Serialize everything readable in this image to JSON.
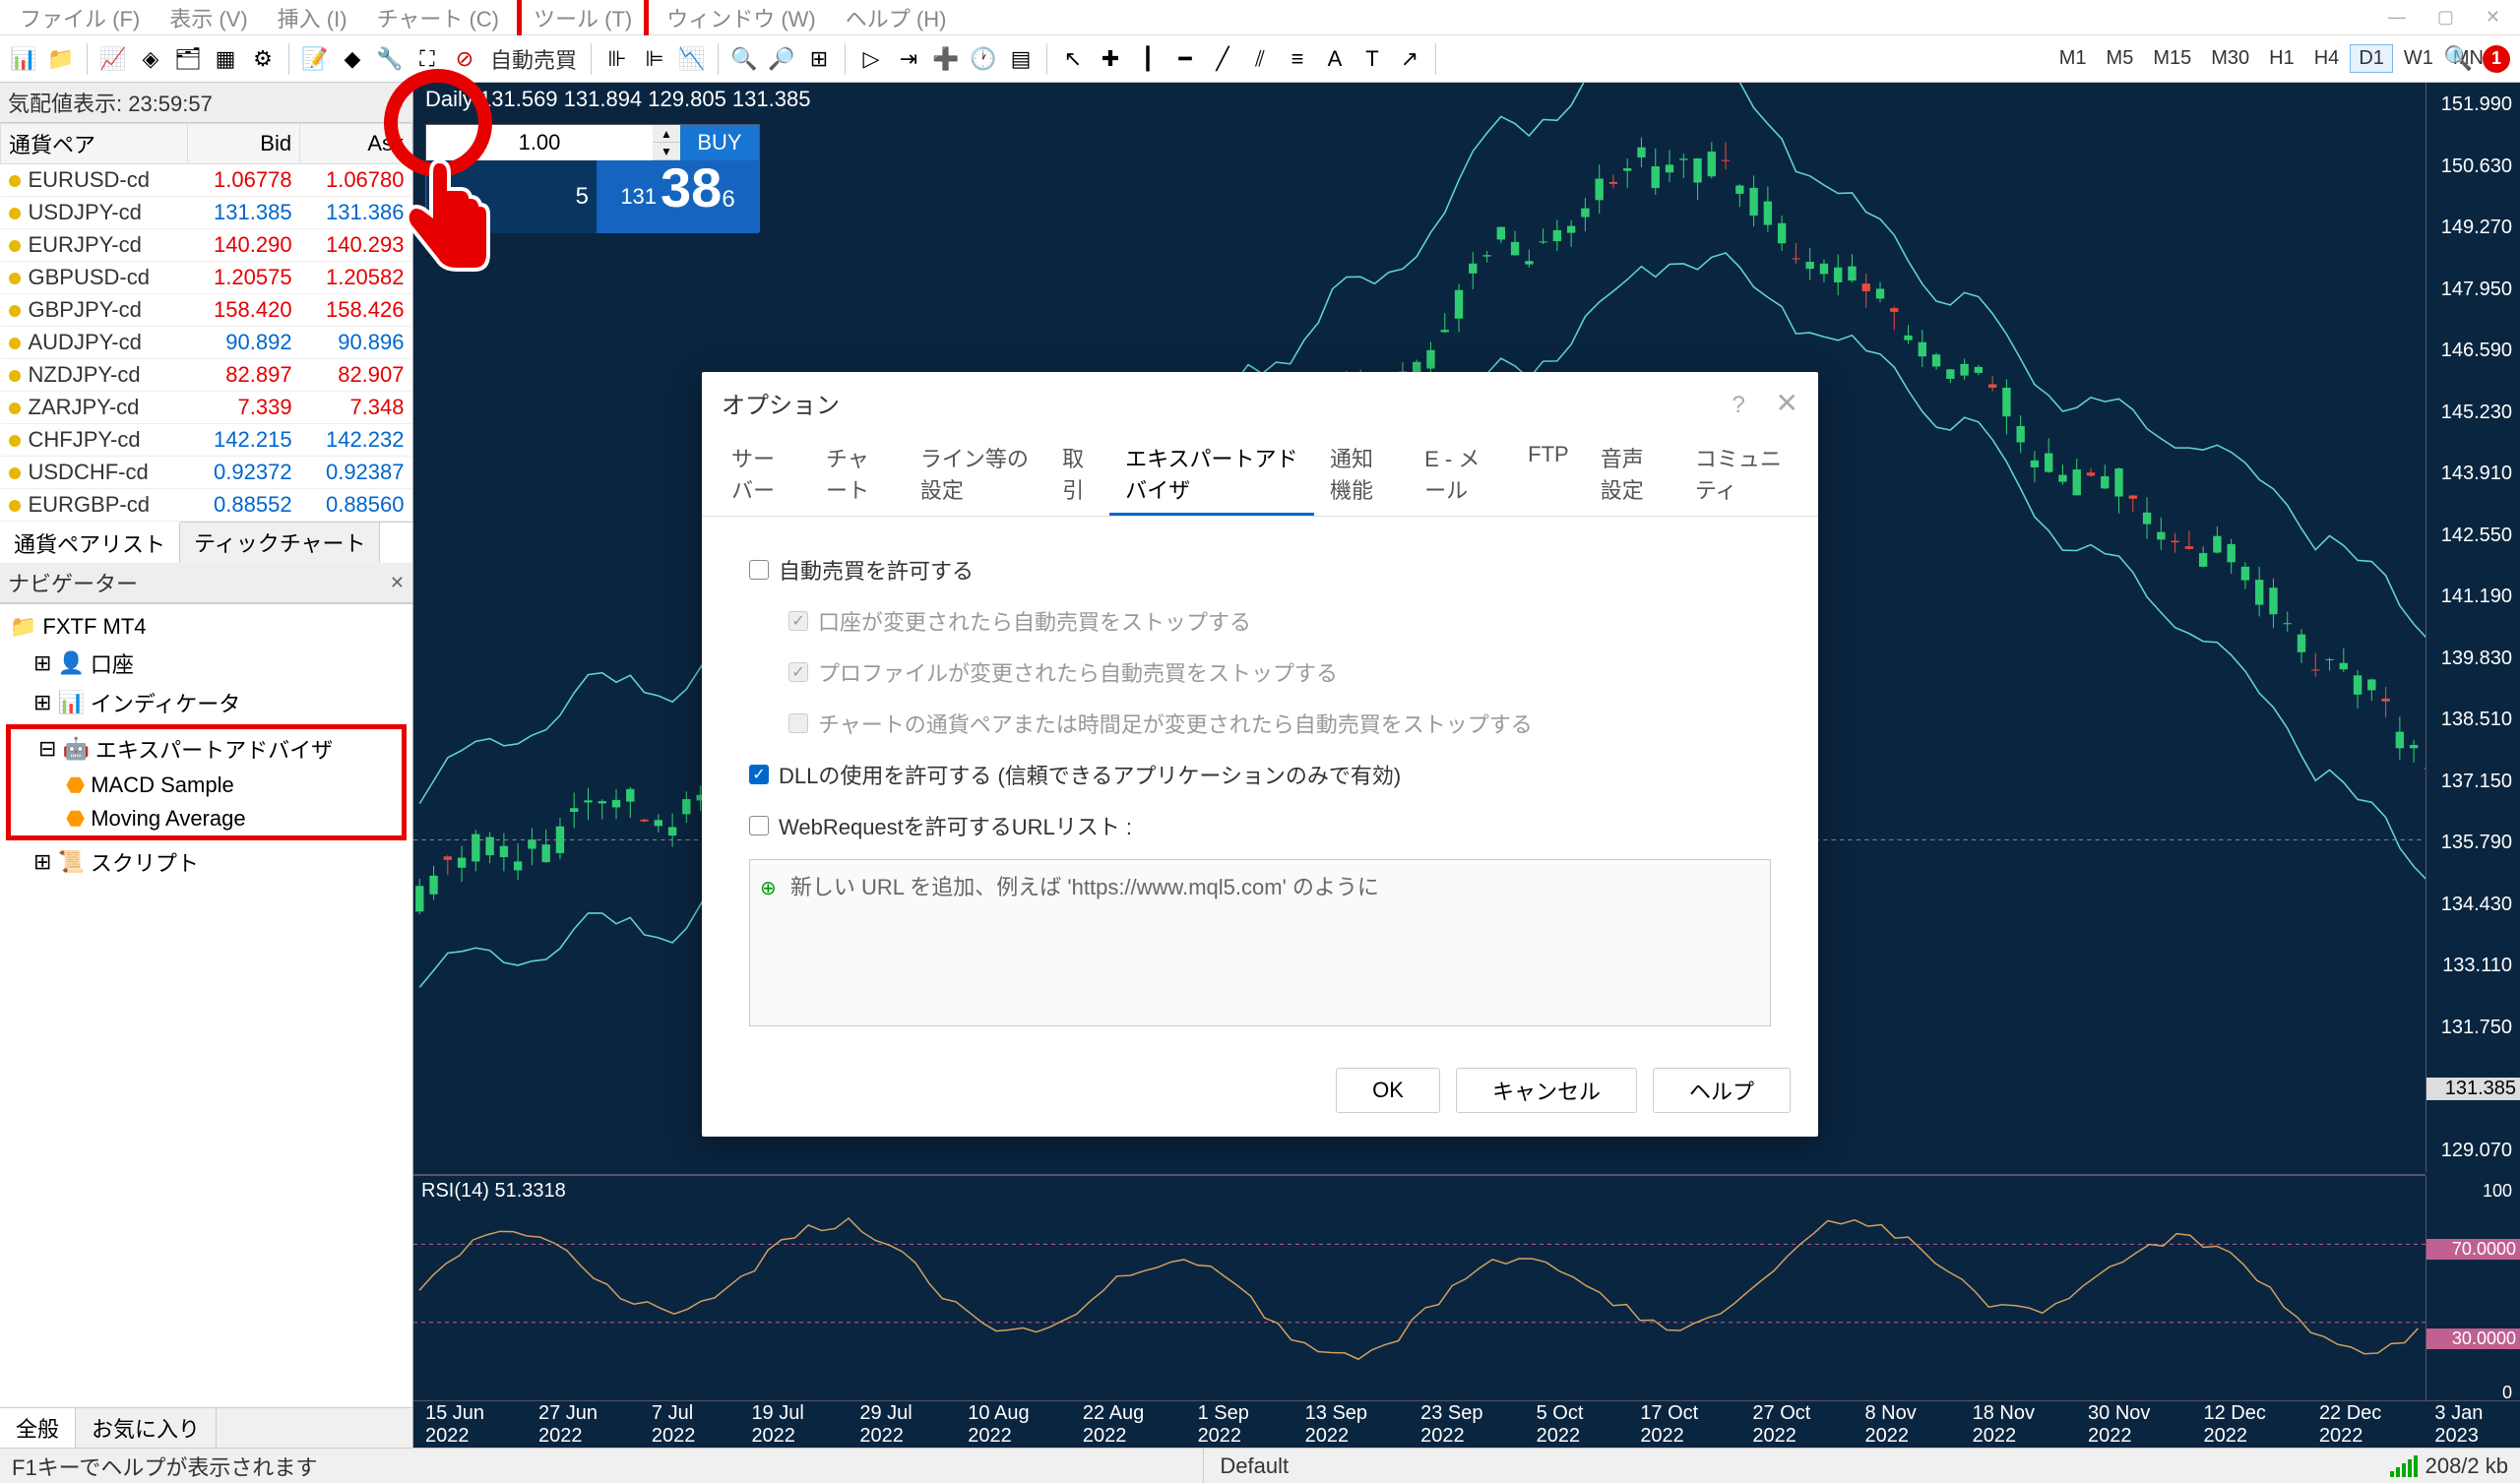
{
  "menu": {
    "items": [
      "ファイル (F)",
      "表示 (V)",
      "挿入 (I)",
      "チャート (C)",
      "ツール (T)",
      "ウィンドウ (W)",
      "ヘルプ (H)"
    ],
    "highlighted_index": 4
  },
  "toolbar": {
    "auto_trade": "自動売買",
    "timeframes": [
      "M1",
      "M5",
      "M15",
      "M30",
      "H1",
      "H4",
      "D1",
      "W1",
      "MN"
    ],
    "active_tf": "D1",
    "alert_count": "1"
  },
  "market_watch": {
    "title": "気配値表示: 23:59:57",
    "cols": [
      "通貨ペア",
      "Bid",
      "Ask"
    ],
    "rows": [
      {
        "s": "EURUSD-cd",
        "b": "1.06778",
        "a": "1.06780",
        "bd": "down",
        "ad": "down",
        "dot": "#e6b800"
      },
      {
        "s": "USDJPY-cd",
        "b": "131.385",
        "a": "131.386",
        "bd": "up",
        "ad": "up",
        "dot": "#e6b800"
      },
      {
        "s": "EURJPY-cd",
        "b": "140.290",
        "a": "140.293",
        "bd": "down",
        "ad": "down",
        "dot": "#e6b800"
      },
      {
        "s": "GBPUSD-cd",
        "b": "1.20575",
        "a": "1.20582",
        "bd": "down",
        "ad": "down",
        "dot": "#e6b800"
      },
      {
        "s": "GBPJPY-cd",
        "b": "158.420",
        "a": "158.426",
        "bd": "down",
        "ad": "down",
        "dot": "#e6b800"
      },
      {
        "s": "AUDJPY-cd",
        "b": "90.892",
        "a": "90.896",
        "bd": "up",
        "ad": "up",
        "dot": "#e6b800"
      },
      {
        "s": "NZDJPY-cd",
        "b": "82.897",
        "a": "82.907",
        "bd": "down",
        "ad": "down",
        "dot": "#e6b800"
      },
      {
        "s": "ZARJPY-cd",
        "b": "7.339",
        "a": "7.348",
        "bd": "down",
        "ad": "down",
        "dot": "#e6b800"
      },
      {
        "s": "CHFJPY-cd",
        "b": "142.215",
        "a": "142.232",
        "bd": "up",
        "ad": "up",
        "dot": "#e6b800"
      },
      {
        "s": "USDCHF-cd",
        "b": "0.92372",
        "a": "0.92387",
        "bd": "up",
        "ad": "up",
        "dot": "#e6b800"
      },
      {
        "s": "EURGBP-cd",
        "b": "0.88552",
        "a": "0.88560",
        "bd": "up",
        "ad": "up",
        "dot": "#e6b800"
      }
    ],
    "tabs": [
      "通貨ペアリスト",
      "ティックチャート"
    ]
  },
  "navigator": {
    "title": "ナビゲーター",
    "root": "FXTF MT4",
    "nodes": {
      "accounts": "口座",
      "indicators": "インディケータ",
      "ea": "エキスパートアドバイザ",
      "ea_children": [
        "MACD Sample",
        "Moving Average"
      ],
      "scripts": "スクリプト"
    },
    "tabs": [
      "全般",
      "お気に入り"
    ]
  },
  "chart": {
    "header": "Daily  131.569 131.894 129.805 131.385",
    "oneclick": {
      "lot": "1.00",
      "buy_label": "BUY",
      "sell_small": "5",
      "buy_small": "131",
      "buy_big": "38",
      "buy_sup": "6"
    },
    "price_ticks": [
      "151.990",
      "150.630",
      "149.270",
      "147.950",
      "146.590",
      "145.230",
      "143.910",
      "142.550",
      "141.190",
      "139.830",
      "138.510",
      "137.150",
      "135.790",
      "134.430",
      "133.110",
      "131.750",
      "131.385",
      "129.070"
    ],
    "rsi_label": "RSI(14) 51.3318",
    "rsi_ticks": [
      "100",
      "70.0000",
      "30.0000",
      "0"
    ],
    "time_ticks": [
      "15 Jun 2022",
      "27 Jun 2022",
      "7 Jul 2022",
      "19 Jul 2022",
      "29 Jul 2022",
      "10 Aug 2022",
      "22 Aug 2022",
      "1 Sep 2022",
      "13 Sep 2022",
      "23 Sep 2022",
      "5 Oct 2022",
      "17 Oct 2022",
      "27 Oct 2022",
      "8 Nov 2022",
      "18 Nov 2022",
      "30 Nov 2022",
      "12 Dec 2022",
      "22 Dec 2022",
      "3 Jan 2023"
    ]
  },
  "dialog": {
    "title": "オプション",
    "help": "?",
    "tabs": [
      "サーバー",
      "チャート",
      "ライン等の設定",
      "取引",
      "エキスパートアドバイザ",
      "通知機能",
      "E - メール",
      "FTP",
      "音声設定",
      "コミュニティ"
    ],
    "active_tab": 4,
    "opts": {
      "allow_auto": "自動売買を許可する",
      "stop_acct": "口座が変更されたら自動売買をストップする",
      "stop_prof": "プロファイルが変更されたら自動売買をストップする",
      "stop_sym": "チャートの通貨ペアまたは時間足が変更されたら自動売買をストップする",
      "allow_dll": "DLLの使用を許可する (信頼できるアプリケーションのみで有効)",
      "allow_web": "WebRequestを許可するURLリスト :",
      "url_hint": "新しい URL を追加、例えば 'https://www.mql5.com' のように"
    },
    "buttons": {
      "ok": "OK",
      "cancel": "キャンセル",
      "help": "ヘルプ"
    }
  },
  "statusbar": {
    "hint": "F1キーでヘルプが表示されます",
    "profile": "Default",
    "conn": "208/2 kb"
  },
  "chart_data": {
    "type": "candlestick",
    "symbol": "USDJPY-cd",
    "timeframe": "D1",
    "ohlc_header": [
      131.569,
      131.894,
      129.805,
      131.385
    ],
    "y_range": [
      129.07,
      151.99
    ],
    "time_range": [
      "2022-06-15",
      "2023-01-06"
    ],
    "indicators": [
      {
        "name": "Bollinger Bands",
        "period": 20
      },
      {
        "name": "RSI",
        "period": 14,
        "value": 51.3318,
        "levels": [
          30,
          70
        ]
      }
    ]
  }
}
